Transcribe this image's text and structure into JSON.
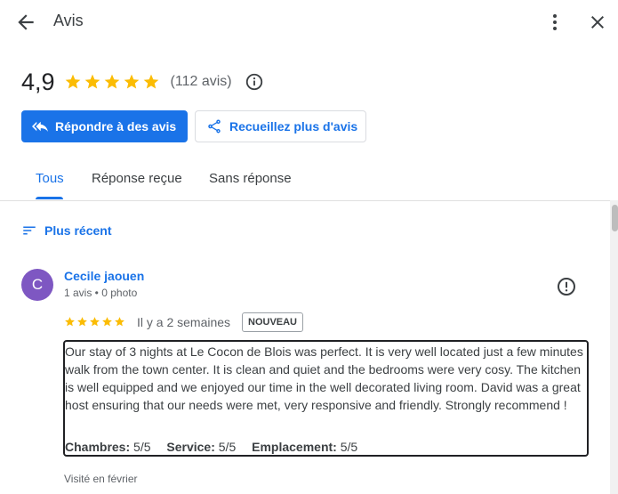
{
  "header": {
    "title": "Avis"
  },
  "summary": {
    "rating": "4,9",
    "stars": 5,
    "count_text": "(112 avis)"
  },
  "actions": {
    "reply_label": "Répondre à des avis",
    "collect_label": "Recueillez plus d'avis"
  },
  "tabs": [
    {
      "label": "Tous",
      "active": true
    },
    {
      "label": "Réponse reçue",
      "active": false
    },
    {
      "label": "Sans réponse",
      "active": false
    }
  ],
  "sort": {
    "label": "Plus récent"
  },
  "review": {
    "avatar_letter": "C",
    "avatar_color": "#7e57c2",
    "name": "Cecile jaouen",
    "meta": "1 avis • 0 photo",
    "stars": 5,
    "date": "Il y a 2 semaines",
    "badge": "NOUVEAU",
    "text": "Our stay of 3 nights at Le Cocon de Blois was perfect. It is very well located just a few minutes walk from the town center. It is clean and quiet and the bedrooms were very cosy. The kitchen is well equipped and we enjoyed our time in the well decorated living room. David was a great host ensuring that our needs were met, very responsive and friendly. Strongly recommend !",
    "ratings": [
      {
        "label": "Chambres:",
        "value": "5/5"
      },
      {
        "label": "Service:",
        "value": "5/5"
      },
      {
        "label": "Emplacement:",
        "value": "5/5"
      }
    ],
    "visited": "Visité en février"
  },
  "colors": {
    "accent": "#1a73e8",
    "star": "#fbbc04"
  },
  "icons": [
    "back-arrow-icon",
    "more-vert-icon",
    "close-icon",
    "star-icon",
    "info-icon",
    "reply-icon",
    "share-icon",
    "sort-icon",
    "flag-icon"
  ]
}
